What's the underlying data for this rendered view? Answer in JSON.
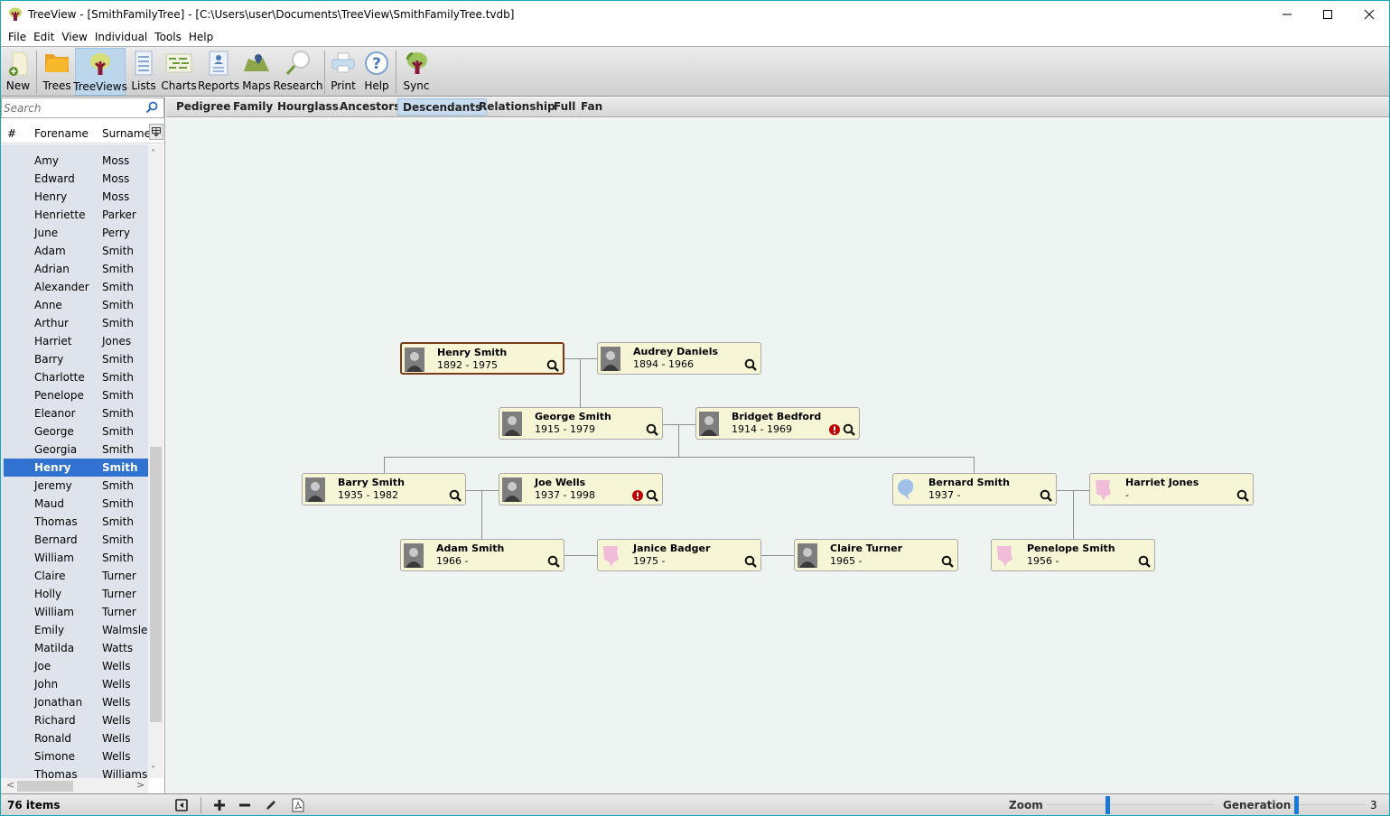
{
  "window": {
    "title": "TreeView - [SmithFamilyTree] - [C:\\Users\\user\\Documents\\TreeView\\SmithFamilyTree.tvdb]",
    "minimize_icon": "minimize-icon",
    "maximize_icon": "maximize-icon",
    "close_icon": "close-icon"
  },
  "menu": [
    "File",
    "Edit",
    "View",
    "Individual",
    "Tools",
    "Help"
  ],
  "toolbar": [
    {
      "label": "New",
      "icon": "new-document-icon"
    },
    {
      "label": "Trees",
      "icon": "folder-icon"
    },
    {
      "label": "TreeViews",
      "icon": "tree-icon",
      "active": true
    },
    {
      "label": "Lists",
      "icon": "list-icon"
    },
    {
      "label": "Charts",
      "icon": "chart-icon"
    },
    {
      "label": "Reports",
      "icon": "report-icon"
    },
    {
      "label": "Maps",
      "icon": "map-icon"
    },
    {
      "label": "Research",
      "icon": "magnifier-icon"
    },
    {
      "label": "Print",
      "icon": "printer-icon"
    },
    {
      "label": "Help",
      "icon": "help-icon"
    },
    {
      "label": "Sync",
      "icon": "sync-icon"
    }
  ],
  "search": {
    "placeholder": "Search",
    "value": ""
  },
  "list": {
    "headers": {
      "num": "#",
      "forename": "Forename",
      "surname": "Surname"
    },
    "rows": [
      {
        "forename": "Amy",
        "surname": "Moss"
      },
      {
        "forename": "Edward",
        "surname": "Moss"
      },
      {
        "forename": "Henry",
        "surname": "Moss"
      },
      {
        "forename": "Henriette",
        "surname": "Parker"
      },
      {
        "forename": "June",
        "surname": "Perry"
      },
      {
        "forename": "Adam",
        "surname": "Smith"
      },
      {
        "forename": "Adrian",
        "surname": "Smith"
      },
      {
        "forename": "Alexander",
        "surname": "Smith"
      },
      {
        "forename": "Anne",
        "surname": "Smith"
      },
      {
        "forename": "Arthur",
        "surname": "Smith"
      },
      {
        "forename": "Harriet",
        "surname": "Jones"
      },
      {
        "forename": "Barry",
        "surname": "Smith"
      },
      {
        "forename": "Charlotte",
        "surname": "Smith"
      },
      {
        "forename": "Penelope",
        "surname": "Smith"
      },
      {
        "forename": "Eleanor",
        "surname": "Smith"
      },
      {
        "forename": "George",
        "surname": "Smith"
      },
      {
        "forename": "Georgia",
        "surname": "Smith"
      },
      {
        "forename": "Henry",
        "surname": "Smith",
        "selected": true
      },
      {
        "forename": "Jeremy",
        "surname": "Smith"
      },
      {
        "forename": "Maud",
        "surname": "Smith"
      },
      {
        "forename": "Thomas",
        "surname": "Smith"
      },
      {
        "forename": "Bernard",
        "surname": "Smith"
      },
      {
        "forename": "William",
        "surname": "Smith"
      },
      {
        "forename": "Claire",
        "surname": "Turner"
      },
      {
        "forename": "Holly",
        "surname": "Turner"
      },
      {
        "forename": "William",
        "surname": "Turner"
      },
      {
        "forename": "Emily",
        "surname": "Walmsley"
      },
      {
        "forename": "Matilda",
        "surname": "Watts"
      },
      {
        "forename": "Joe",
        "surname": "Wells"
      },
      {
        "forename": "John",
        "surname": "Wells"
      },
      {
        "forename": "Jonathan",
        "surname": "Wells"
      },
      {
        "forename": "Richard",
        "surname": "Wells"
      },
      {
        "forename": "Ronald",
        "surname": "Wells"
      },
      {
        "forename": "Simone",
        "surname": "Wells"
      },
      {
        "forename": "Thomas",
        "surname": "Williams"
      }
    ],
    "item_count": "76 items"
  },
  "view_tabs": [
    {
      "label": "Pedigree"
    },
    {
      "label": "Family"
    },
    {
      "label": "Hourglass"
    },
    {
      "label": "Ancestors"
    },
    {
      "label": "Descendants",
      "active": true
    },
    {
      "label": "Relationship"
    },
    {
      "label": "Full"
    },
    {
      "label": "Fan"
    }
  ],
  "tree": {
    "people": [
      {
        "id": "henry",
        "name": "Henry Smith",
        "dates": "1892 - 1975",
        "photo": "photo",
        "focus": true
      },
      {
        "id": "audrey",
        "name": "Audrey Daniels",
        "dates": "1894 - 1966",
        "photo": "photo"
      },
      {
        "id": "george",
        "name": "George Smith",
        "dates": "1915 - 1979",
        "photo": "photo"
      },
      {
        "id": "bridget",
        "name": "Bridget Bedford",
        "dates": "1914 - 1969",
        "photo": "photo",
        "warning": true
      },
      {
        "id": "barry",
        "name": "Barry Smith",
        "dates": "1935 - 1982",
        "photo": "photo"
      },
      {
        "id": "joe",
        "name": "Joe Wells",
        "dates": "1937 - 1998",
        "photo": "photo",
        "warning": true
      },
      {
        "id": "bernard",
        "name": "Bernard Smith",
        "dates": "1937 -",
        "photo": "male-silhouette"
      },
      {
        "id": "harriet",
        "name": "Harriet Jones",
        "dates": "-",
        "photo": "female-silhouette"
      },
      {
        "id": "adam",
        "name": "Adam Smith",
        "dates": "1966 -",
        "photo": "photo"
      },
      {
        "id": "janice",
        "name": "Janice Badger",
        "dates": "1975 -",
        "photo": "female-silhouette"
      },
      {
        "id": "claire",
        "name": "Claire Turner",
        "dates": "1965 -",
        "photo": "photo"
      },
      {
        "id": "penelope",
        "name": "Penelope Smith",
        "dates": "1956 -",
        "photo": "female-silhouette"
      }
    ]
  },
  "statusbar": {
    "zoom_label": "Zoom",
    "zoom_level": 0.35,
    "generation_label": "Generation",
    "generation_value": "3",
    "generation_level": 0.05
  },
  "colors": {
    "accent": "#3072d0",
    "slider": "#1a78d6",
    "card_bg": "#f6f5d6",
    "canvas_bg": "#eef4f1",
    "warning": "#c00000"
  }
}
